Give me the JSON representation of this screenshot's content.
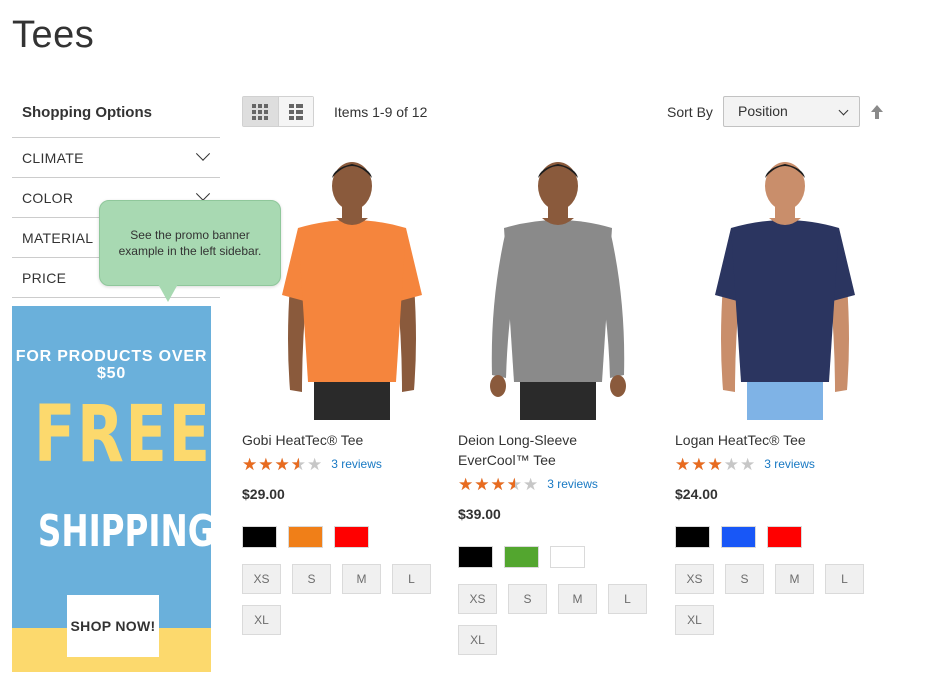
{
  "page": {
    "title": "Tees"
  },
  "sidebar": {
    "title": "Shopping Options",
    "filters": [
      {
        "label": "CLIMATE"
      },
      {
        "label": "COLOR"
      },
      {
        "label": "MATERIAL"
      },
      {
        "label": "PRICE"
      }
    ],
    "tooltip": "See the promo banner example in the left sidebar.",
    "promo": {
      "top_line": "FOR PRODUCTS OVER $50",
      "headline": "FREE",
      "subheadline": "SHIPPING",
      "button": "SHOP NOW!",
      "colors": {
        "background": "#6ab0db",
        "accent": "#fcd96d"
      }
    }
  },
  "toolbar": {
    "view_grid_icon": "grid-view-icon",
    "view_list_icon": "list-view-icon",
    "items_count": "Items 1-9 of 12",
    "sort_label": "Sort By",
    "sort_value": "Position",
    "sort_direction_icon": "sort-ascending-arrow-icon"
  },
  "products": [
    {
      "name": "Gobi HeatTec® Tee",
      "rating": 3.5,
      "reviews": "3 reviews",
      "price": "$29.00",
      "shirt_color": "#f5853d",
      "shirt_style": "short",
      "swatches": [
        "#000000",
        "#f07f18",
        "#ff0000"
      ],
      "sizes": [
        "XS",
        "S",
        "M",
        "L",
        "XL"
      ]
    },
    {
      "name": "Deion Long-Sleeve EverCool™ Tee",
      "rating": 3.5,
      "reviews": "3 reviews",
      "price": "$39.00",
      "shirt_color": "#8a8a8a",
      "shirt_style": "long",
      "swatches": [
        "#000000",
        "#53a62f",
        "#ffffff"
      ],
      "sizes": [
        "XS",
        "S",
        "M",
        "L",
        "XL"
      ]
    },
    {
      "name": "Logan HeatTec® Tee",
      "rating": 3,
      "reviews": "3 reviews",
      "price": "$24.00",
      "shirt_color": "#2b3560",
      "shirt_style": "short",
      "swatches": [
        "#000000",
        "#1857f7",
        "#ff0000"
      ],
      "sizes": [
        "XS",
        "S",
        "M",
        "L",
        "XL"
      ]
    }
  ],
  "colors": {
    "rating": "#e86b1f",
    "link": "#1979c3"
  }
}
